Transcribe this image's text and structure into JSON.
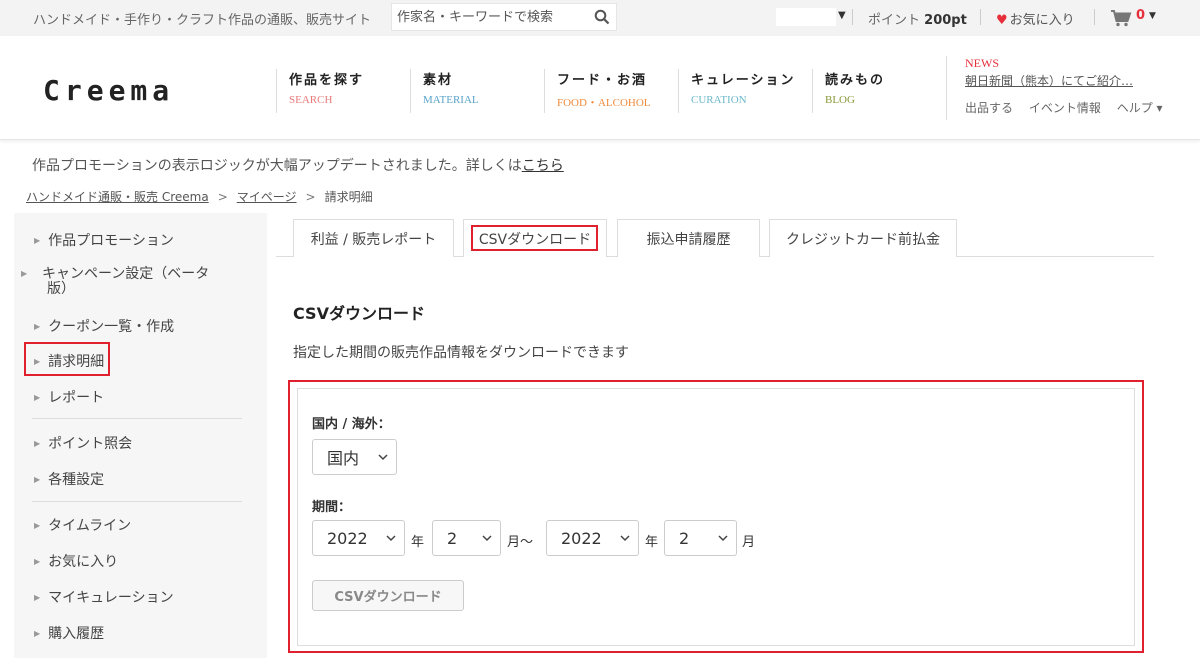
{
  "topbar": {
    "tagline": "ハンドメイド・手作り・クラフト作品の通販、販売サイト",
    "search_placeholder": "作家名・キーワードで検索",
    "points_label": "ポイント",
    "points_value": "200pt",
    "favorites_label": "お気に入り",
    "cart_count": "0"
  },
  "header": {
    "logo": "Creema",
    "nav": [
      {
        "jp": "作品を探す",
        "en": "SEARCH",
        "color": "#e87b7b"
      },
      {
        "jp": "素材",
        "en": "MATERIAL",
        "color": "#5aa3c8"
      },
      {
        "jp": "フード・お酒",
        "en": "FOOD・ALCOHOL",
        "color": "#f08a3c"
      },
      {
        "jp": "キュレーション",
        "en": "CURATION",
        "color": "#6bb8c9"
      },
      {
        "jp": "読みもの",
        "en": "BLOG",
        "color": "#8a9a3a"
      }
    ],
    "news_label": "NEWS",
    "news_headline": "朝日新聞（熊本）にてご紹介…",
    "links": [
      "出品する",
      "イベント情報",
      "ヘルプ ▾"
    ]
  },
  "notice": {
    "text": "作品プロモーションの表示ロジックが大幅アップデートされました。詳しくは",
    "link": "こちら"
  },
  "breadcrumb": [
    "ハンドメイド通販・販売 Creema",
    "マイページ",
    "請求明細"
  ],
  "sidebar": {
    "items": [
      "作品プロモーション",
      "キャンペーン設定（ベータ版）",
      "クーポン一覧・作成",
      "請求明細",
      "レポート",
      "ポイント照会",
      "各種設定",
      "タイムライン",
      "お気に入り",
      "マイキュレーション",
      "購入履歴"
    ]
  },
  "tabs": [
    "利益 / 販売レポート",
    "CSVダウンロード",
    "振込申請履歴",
    "クレジットカード前払金"
  ],
  "content": {
    "title": "CSVダウンロード",
    "description": "指定した期間の販売作品情報をダウンロードできます",
    "region_label": "国内 / 海外：",
    "region_value": "国内",
    "period_label": "期間：",
    "start_year": "2022",
    "start_month": "2",
    "end_year": "2022",
    "end_month": "2",
    "unit_year": "年",
    "unit_month": "月",
    "unit_month_tilde": "月～",
    "download_button": "CSVダウンロード"
  },
  "colors": {
    "highlight": "#e0202e",
    "accent_red": "#e6303b"
  }
}
